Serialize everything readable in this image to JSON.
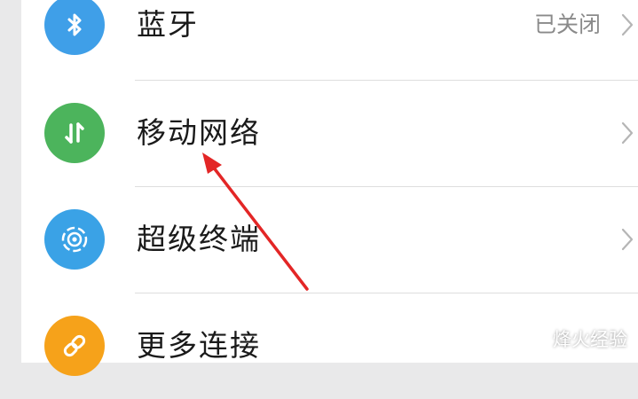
{
  "settings": {
    "items": [
      {
        "label": "蓝牙",
        "value": "已关闭",
        "icon": "bluetooth-icon",
        "icon_color": "#3f9fe8"
      },
      {
        "label": "移动网络",
        "value": "",
        "icon": "mobile-data-icon",
        "icon_color": "#4cb45c"
      },
      {
        "label": "超级终端",
        "value": "",
        "icon": "super-device-icon",
        "icon_color": "#3aa2e6"
      },
      {
        "label": "更多连接",
        "value": "",
        "icon": "link-icon",
        "icon_color": "#f6a21a"
      }
    ]
  },
  "annotation": {
    "arrow_color": "#e32626",
    "points_to": "移动网络"
  },
  "watermark": {
    "text": "烽火经验"
  },
  "colors": {
    "page_background": "#e9e9ea",
    "card_background": "#ffffff",
    "divider": "#dedede",
    "secondary_text": "#8a8a8a",
    "chevron": "#b5b5b5"
  }
}
